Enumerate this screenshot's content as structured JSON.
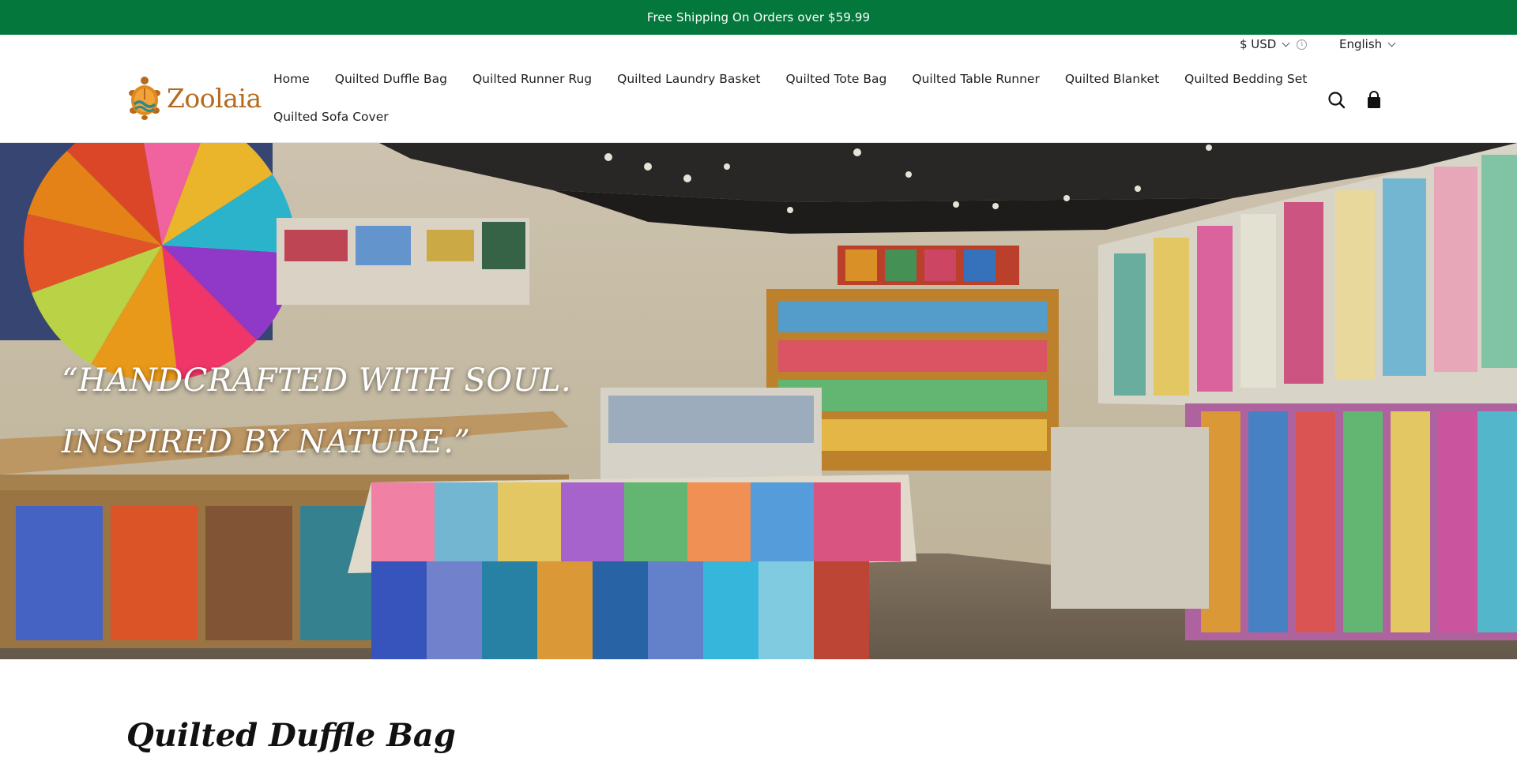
{
  "announcement": {
    "text": "Free Shipping On Orders over $59.99"
  },
  "locale": {
    "currency": "$ USD",
    "language": "English"
  },
  "brand": {
    "name": "Zoolaia"
  },
  "nav": {
    "row1": [
      "Home",
      "Quilted Duffle Bag",
      "Quilted Runner Rug",
      "Quilted Laundry Basket",
      "Quilted Tote Bag",
      "Quilted Table Runner",
      "Quilted Blanket",
      "Quilted Bedding Set"
    ],
    "row2": [
      "Quilted Sofa Cover"
    ]
  },
  "icons": {
    "search": "search-icon",
    "cart": "shopping-bag-icon",
    "info": "info-icon",
    "currency_dropdown": "chevron-down-icon",
    "language_dropdown": "chevron-down-icon"
  },
  "hero": {
    "quote_line1": "“HANDCRAFTED WITH SOUL.",
    "quote_line2": "INSPIRED BY NATURE.”"
  },
  "section": {
    "title": "Quilted Duffle Bag"
  },
  "colors": {
    "announcement_bg": "#04773d",
    "brand_orange": "#b56a1e",
    "brand_teal": "#2a8a8c"
  }
}
